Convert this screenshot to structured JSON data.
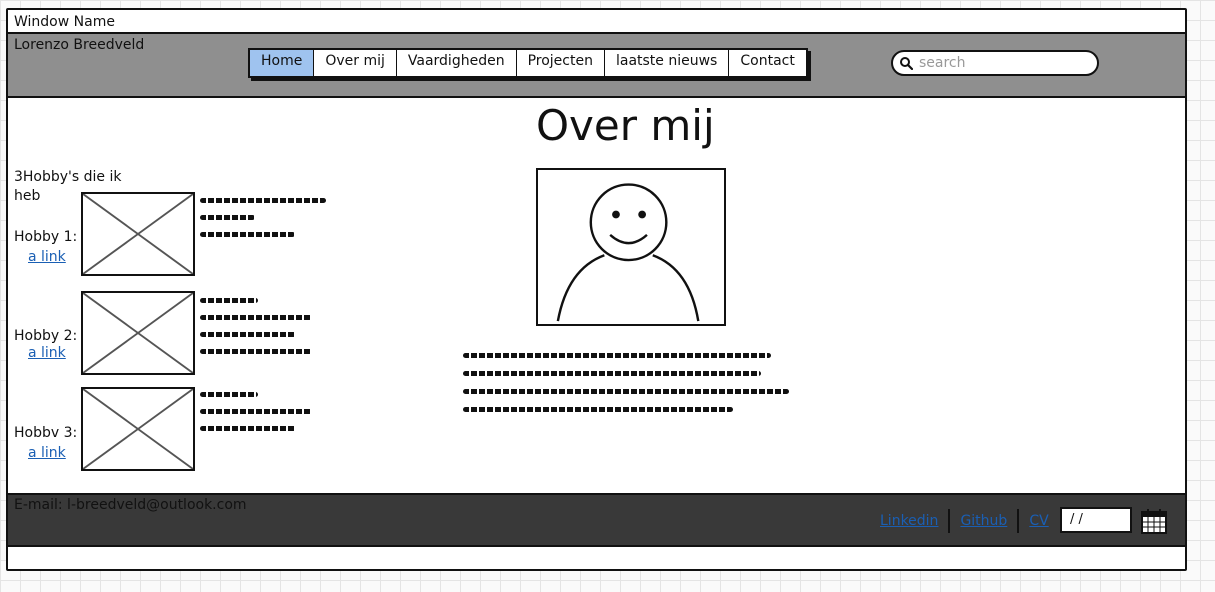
{
  "window": {
    "title": "Window Name"
  },
  "header": {
    "brand": "Lorenzo Breedveld",
    "nav": [
      "Home",
      "Over mij",
      "Vaardigheden",
      "Projecten",
      "laatste nieuws",
      "Contact"
    ],
    "active_nav": "Home",
    "search_placeholder": "search",
    "search_icon": "search-icon"
  },
  "main": {
    "title": "Over mij",
    "hobbies_title": "3Hobby's die ik heb",
    "hobbies": [
      {
        "label": "Hobby 1:",
        "link": "a link"
      },
      {
        "label": "Hobby 2:",
        "link": "a link"
      },
      {
        "label": "Hobbv 3:",
        "link": "a link"
      }
    ],
    "avatar_icon": "smiley-avatar-icon"
  },
  "footer": {
    "email": "E-mail: l-breedveld@outlook.com",
    "links": [
      "Linkedin",
      "Github",
      "CV"
    ],
    "date_value": "/ /",
    "calendar_icon": "calendar-icon"
  },
  "colors": {
    "header_bg": "#8f8f8f",
    "footer_bg": "#393939",
    "active_tab": "#9fc3ef",
    "link": "#1a5fb4"
  }
}
